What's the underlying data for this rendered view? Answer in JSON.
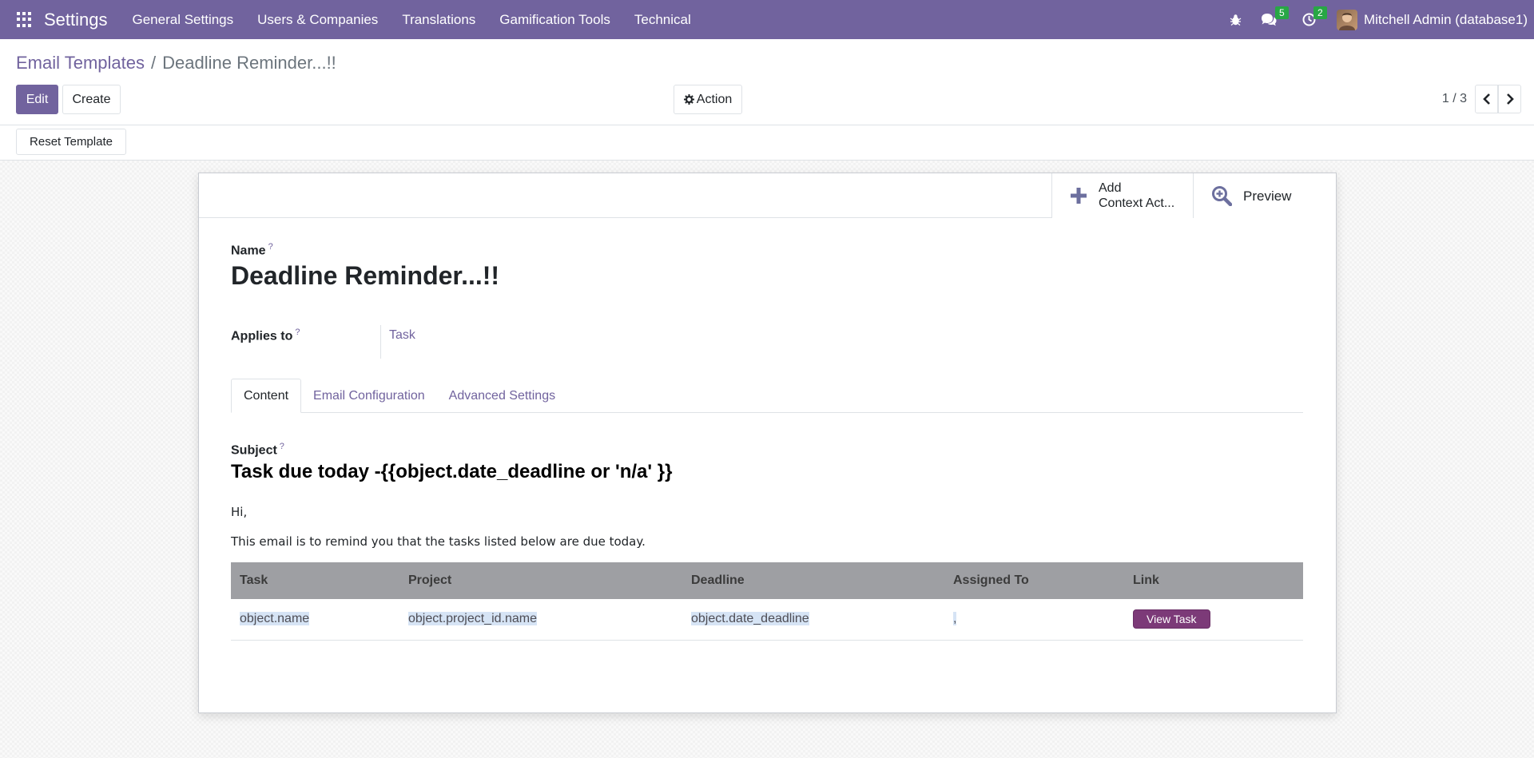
{
  "navbar": {
    "app_name": "Settings",
    "menu": [
      "General Settings",
      "Users & Companies",
      "Translations",
      "Gamification Tools",
      "Technical"
    ],
    "messages_count": "5",
    "activities_count": "2",
    "user": "Mitchell Admin (database1)",
    "icons": [
      "apps-grid-icon",
      "bug-icon",
      "chat-icon",
      "clock-icon"
    ],
    "color": "#71639e"
  },
  "breadcrumb": {
    "parent": "Email Templates",
    "separator": "/",
    "current": "Deadline Reminder...!!"
  },
  "toolbar": {
    "edit_label": "Edit",
    "create_label": "Create",
    "action_label": "Action",
    "pager": "1 / 3"
  },
  "statusbar": {
    "reset_label": "Reset Template"
  },
  "smart_buttons": {
    "add_context_line1": "Add",
    "add_context_line2": "Context Act...",
    "preview": "Preview"
  },
  "form": {
    "name_label": "Name",
    "help_mark": "?",
    "name_value": "Deadline Reminder...!!",
    "applies_to_label": "Applies to",
    "applies_to_value": "Task"
  },
  "tabs": [
    "Content",
    "Email Configuration",
    "Advanced Settings"
  ],
  "content": {
    "subject_label": "Subject",
    "subject_value": "Task due today -{{object.date_deadline or 'n/a' }}",
    "greeting": "Hi,",
    "intro": "This email is to remind you that the tasks listed below are due today.",
    "table": {
      "headers": [
        "Task",
        "Project",
        "Deadline",
        "Assigned To",
        "Link"
      ],
      "row": [
        "object.name",
        "object.project_id.name",
        "object.date_deadline",
        ",",
        "View Task"
      ]
    }
  }
}
